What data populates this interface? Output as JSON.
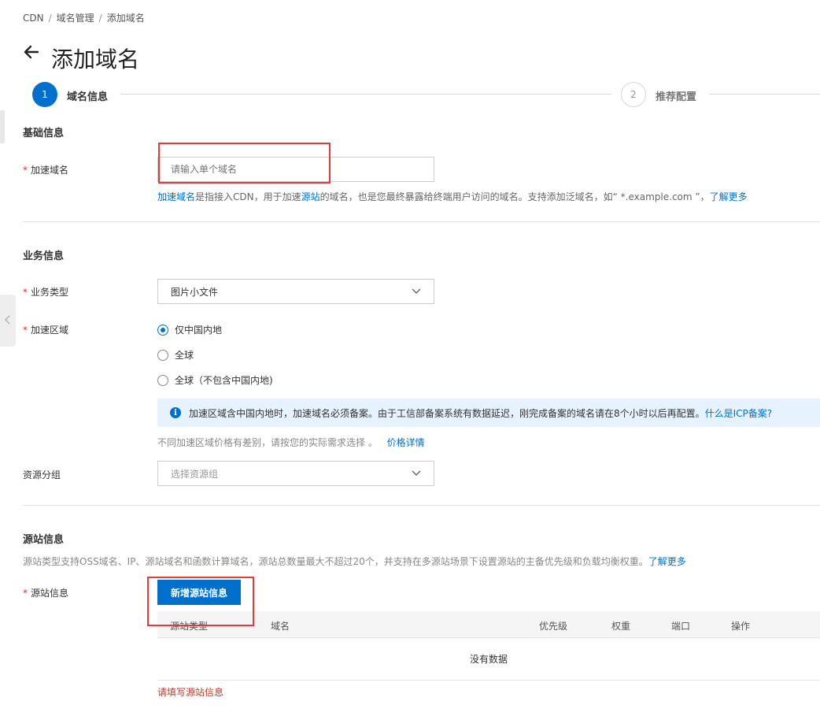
{
  "breadcrumb": [
    "CDN",
    "域名管理",
    "添加域名"
  ],
  "page_title": "添加域名",
  "steps": [
    {
      "number": "1",
      "label": "域名信息"
    },
    {
      "number": "2",
      "label": "推荐配置"
    }
  ],
  "basic": {
    "title": "基础信息",
    "domain_label": "加速域名",
    "domain_placeholder": "请输入单个域名",
    "help_link": "加速域名",
    "help_text_1": "是指接入CDN，用于加速",
    "help_link_2": "源站",
    "help_text_2": "的域名，也是您最终暴露给终端用户访问的域名。支持添加泛域名，如“ *.example.com ”，",
    "help_more": "了解更多"
  },
  "business": {
    "title": "业务信息",
    "type_label": "业务类型",
    "type_value": "图片小文件",
    "region_label": "加速区域",
    "region_options": [
      "仅中国内地",
      "全球",
      "全球（不包含中国内地)"
    ],
    "region_selected": 0,
    "alert_text": "加速区域含中国内地时，加速域名必须备案。由于工信部备案系统有数据延迟，刚完成备案的域名请在8个小时以后再配置。",
    "alert_link": "什么是ICP备案?",
    "price_note": "不同加速区域价格有差别，请按您的实际需求选择 。",
    "price_link": "价格详情",
    "group_label": "资源分组",
    "group_placeholder": "选择资源组"
  },
  "origin": {
    "title": "源站信息",
    "desc": "源站类型支持OSS域名、IP、源站域名和函数计算域名，源站总数量最大不超过20个，并支持在多源站场景下设置源站的主备优先级和负载均衡权重。",
    "desc_link": "了解更多",
    "label": "源站信息",
    "add_button": "新增源站信息",
    "columns": [
      "源站类型",
      "域名",
      "优先级",
      "权重",
      "端口",
      "操作"
    ],
    "empty_text": "没有数据",
    "error_text": "请填写源站信息"
  },
  "colors": {
    "primary": "#0070cc",
    "required": "#d93026",
    "annotation": "#e33b3b",
    "alert_bg": "#e6f3ff"
  }
}
